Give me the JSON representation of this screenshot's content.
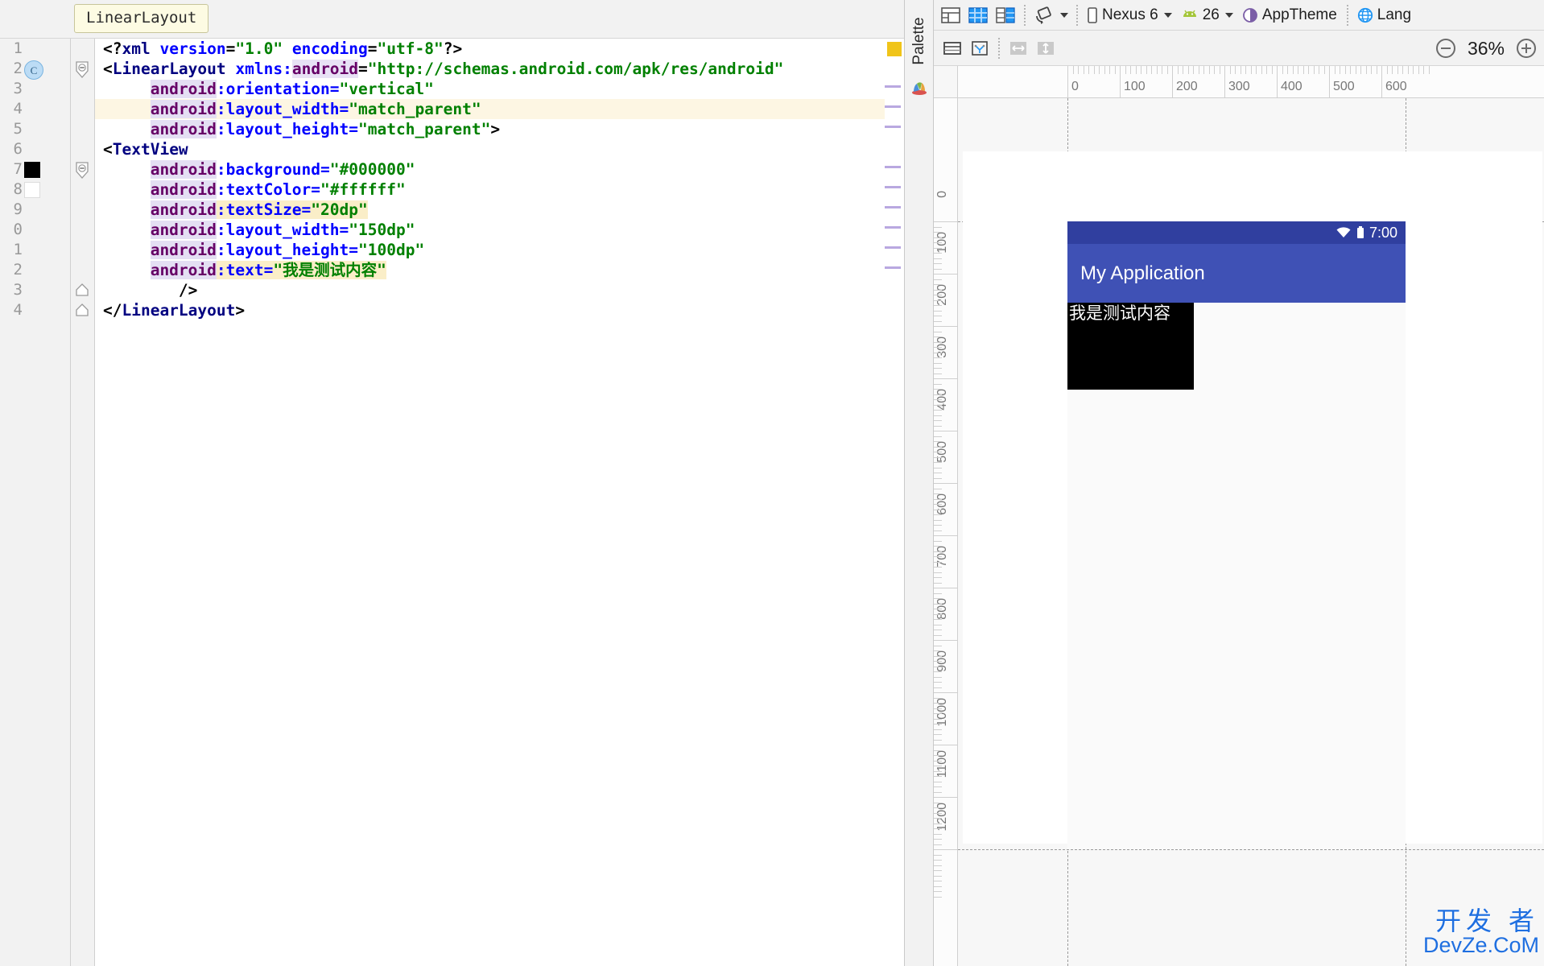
{
  "editor": {
    "breadcrumb": "LinearLayout",
    "highlighted_line": 4,
    "lines": [
      {
        "n": "1",
        "gutter_icon": "none"
      },
      {
        "n": "2",
        "gutter_icon": "class-badge"
      },
      {
        "n": "3",
        "gutter_icon": "none"
      },
      {
        "n": "4",
        "gutter_icon": "none"
      },
      {
        "n": "5",
        "gutter_icon": "none"
      },
      {
        "n": "6",
        "gutter_icon": "none"
      },
      {
        "n": "7",
        "gutter_icon": "color-swatch-black"
      },
      {
        "n": "8",
        "gutter_icon": "color-swatch-white"
      },
      {
        "n": "9",
        "gutter_icon": "none"
      },
      {
        "n": "0",
        "gutter_icon": "none"
      },
      {
        "n": "1",
        "gutter_icon": "none"
      },
      {
        "n": "2",
        "gutter_icon": "none"
      },
      {
        "n": "3",
        "gutter_icon": "none"
      },
      {
        "n": "4",
        "gutter_icon": "none"
      }
    ],
    "class_badge_letter": "C",
    "code": [
      "<?xml version=\"1.0\" encoding=\"utf-8\"?>",
      "<LinearLayout xmlns:android=\"http://schemas.android.com/apk/res/android\"",
      "    android:orientation=\"vertical\"",
      "    android:layout_width=\"match_parent\"",
      "    android:layout_height=\"match_parent\">",
      "<TextView",
      "    android:background=\"#000000\"",
      "    android:textColor=\"#ffffff\"",
      "    android:textSize=\"20dp\"",
      "    android:layout_width=\"150dp\"",
      "    android:layout_height=\"100dp\"",
      "    android:text=\"我是测试内容\"",
      "    />",
      "</LinearLayout>"
    ]
  },
  "palette": {
    "label": "Palette",
    "icon": "palette-icon"
  },
  "design_toolbar": {
    "buttons": [
      {
        "name": "design-mode-button",
        "icon": "layout-blueprint-split-icon",
        "label": ""
      },
      {
        "name": "blueprint-mode-button",
        "icon": "blueprint-grid-icon",
        "label": ""
      },
      {
        "name": "both-mode-button",
        "icon": "design-and-blueprint-icon",
        "label": ""
      },
      {
        "name": "orientation-button",
        "icon": "rotate-device-icon",
        "label": "",
        "has_caret": true
      },
      {
        "name": "device-selector",
        "icon": "phone-icon",
        "label": "Nexus 6",
        "has_caret": true
      },
      {
        "name": "api-level-selector",
        "icon": "android-robot-icon",
        "label": "26",
        "has_caret": true
      },
      {
        "name": "theme-selector",
        "icon": "theme-contrast-icon",
        "label": "AppTheme",
        "has_caret": false
      },
      {
        "name": "locale-selector",
        "icon": "globe-icon",
        "label": "Lang",
        "has_caret": false
      }
    ]
  },
  "design_toolbar2": {
    "buttons": [
      {
        "name": "show-layout-decorations-button",
        "icon": "layout-rows-icon"
      },
      {
        "name": "show-blueprint-guides-button",
        "icon": "constraints-icon"
      },
      {
        "name": "expand-horizontally-button",
        "icon": "arrows-horizontal-icon"
      },
      {
        "name": "expand-vertically-button",
        "icon": "arrows-vertical-icon"
      }
    ],
    "zoom_out_label": "zoom-out-icon",
    "zoom_level": "36%",
    "zoom_in_label": "zoom-in-icon"
  },
  "rulers": {
    "horizontal_ticks": [
      "0",
      "100",
      "200",
      "300",
      "400",
      "500",
      "600"
    ],
    "vertical_ticks": [
      "0",
      "100",
      "200",
      "300",
      "400",
      "500",
      "600",
      "700",
      "800",
      "900",
      "1000",
      "1100",
      "1200"
    ]
  },
  "device_preview": {
    "status_time": "7:00",
    "app_title": "My Application",
    "textview_text": "我是测试内容",
    "textview_bg": "#000000",
    "textview_color": "#ffffff",
    "action_bar_color": "#3f51b5",
    "status_bar_color": "#303f9f",
    "nav_buttons": [
      "back-triangle-icon",
      "home-circle-icon"
    ]
  },
  "watermark": {
    "cn": "开发 者",
    "en": "DevZe.CoM",
    "color": "#1f6fe0"
  }
}
